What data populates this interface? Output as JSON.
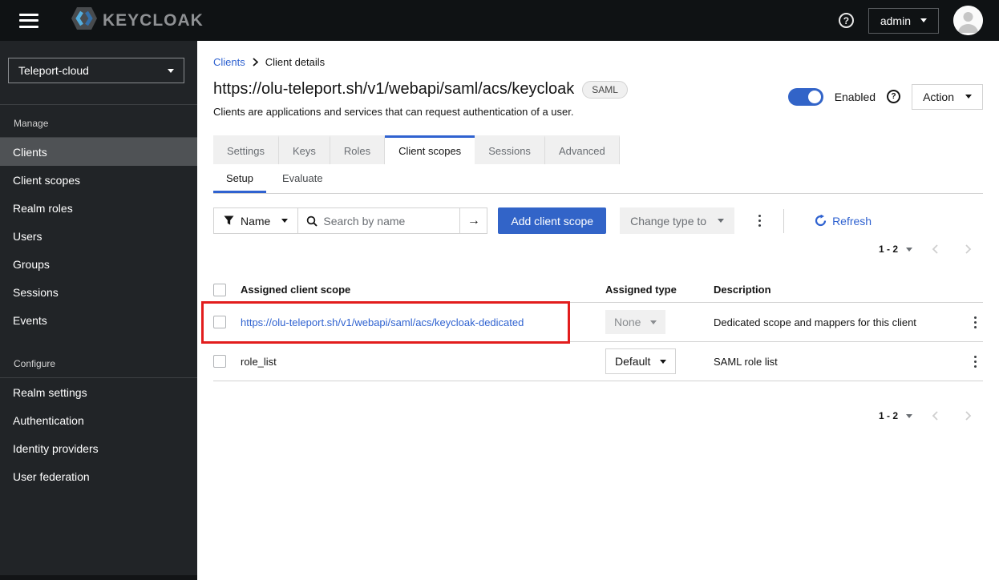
{
  "header": {
    "brand": "KEYCLOAK",
    "help_icon": "?",
    "user_menu": "admin"
  },
  "sidebar": {
    "realm_selector": "Teleport-cloud",
    "groups": [
      {
        "label": "Manage",
        "items": [
          "Clients",
          "Client scopes",
          "Realm roles",
          "Users",
          "Groups",
          "Sessions",
          "Events"
        ]
      },
      {
        "label": "Configure",
        "items": [
          "Realm settings",
          "Authentication",
          "Identity providers",
          "User federation"
        ]
      }
    ],
    "selected_item": "Clients"
  },
  "breadcrumb": {
    "link": "Clients",
    "current": "Client details"
  },
  "page": {
    "title": "https://olu-teleport.sh/v1/webapi/saml/acs/keycloak",
    "badge": "SAML",
    "subtitle": "Clients are applications and services that can request authentication of a user.",
    "enabled_label": "Enabled",
    "help_icon": "?",
    "action_label": "Action"
  },
  "tabs": {
    "items": [
      "Settings",
      "Keys",
      "Roles",
      "Client scopes",
      "Sessions",
      "Advanced"
    ],
    "active": "Client scopes"
  },
  "subtabs": {
    "items": [
      "Setup",
      "Evaluate"
    ],
    "active": "Setup"
  },
  "toolbar": {
    "filter_label": "Name",
    "search_placeholder": "Search by name",
    "add_button": "Add client scope",
    "change_type_label": "Change type to",
    "refresh_label": "Refresh"
  },
  "icons": {
    "arrow_right": "→"
  },
  "pagination": {
    "range": "1 - 2"
  },
  "table": {
    "headers": {
      "scope": "Assigned client scope",
      "type": "Assigned type",
      "description": "Description"
    },
    "rows": [
      {
        "scope": "https://olu-teleport.sh/v1/webapi/saml/acs/keycloak-dedicated",
        "type": "None",
        "description": "Dedicated scope and mappers for this client"
      },
      {
        "scope": "role_list",
        "type": "Default",
        "description": "SAML role list"
      }
    ]
  },
  "colors": {
    "accent_blue": "#3264c8",
    "link_blue": "#2f62d0",
    "header_bg": "#0f1214",
    "sidebar_bg": "#212427",
    "selected_nav_bg": "#4f5255",
    "highlight_red": "#e21d1d"
  }
}
